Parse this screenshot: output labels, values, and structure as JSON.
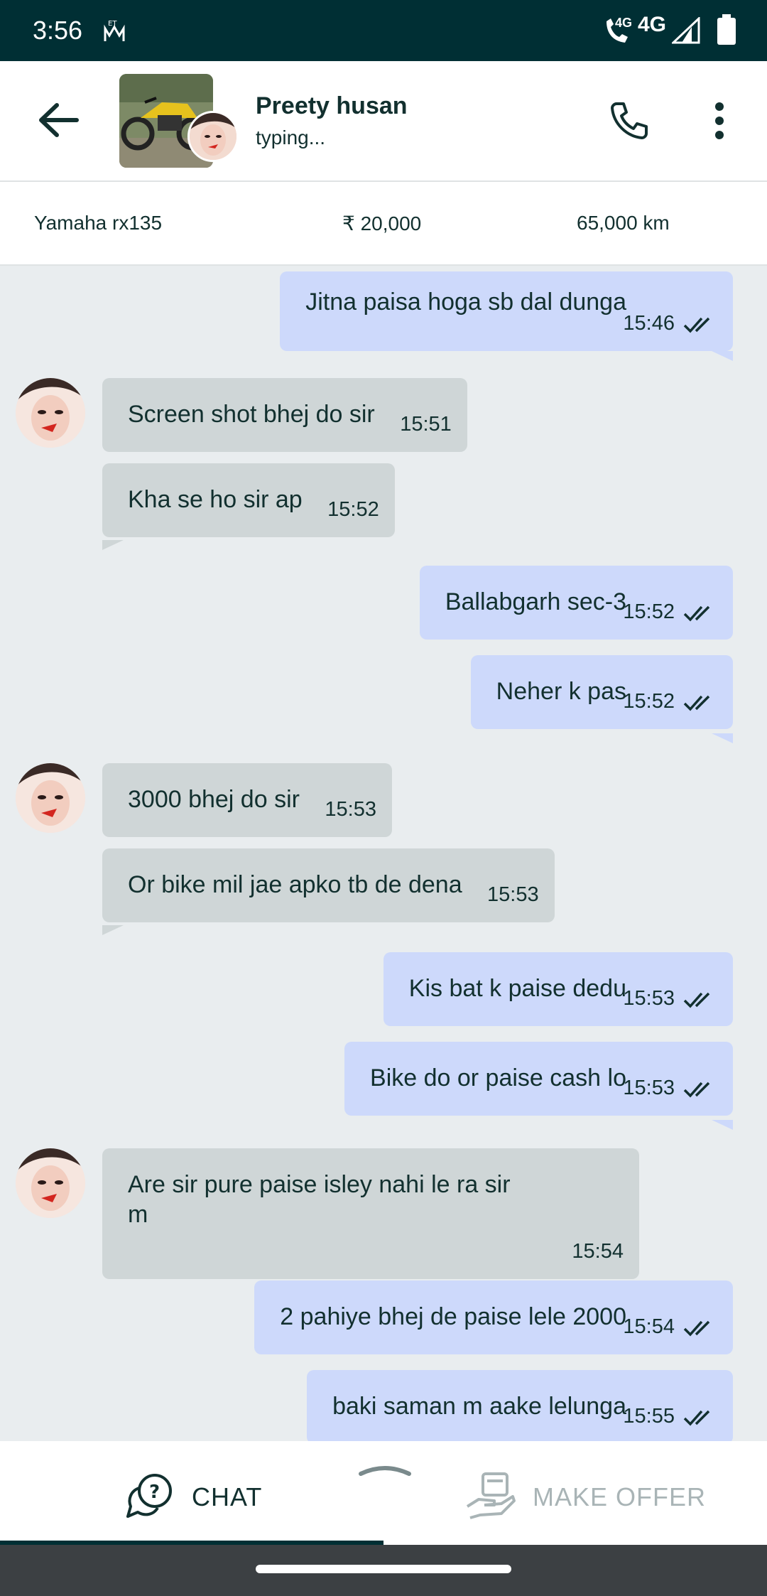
{
  "status_bar": {
    "time": "3:56",
    "network_small": "4G",
    "network": "4G",
    "icons": [
      "om-icon",
      "wifi-calling-icon",
      "signal-icon",
      "battery-icon"
    ]
  },
  "header": {
    "contact_name": "Preety husan",
    "contact_status": "typing...",
    "icons": [
      "back-arrow-icon",
      "phone-icon",
      "more-vert-icon"
    ]
  },
  "listing": {
    "title": "Yamaha rx135",
    "price": "₹ 20,000",
    "km": "65,000 km"
  },
  "messages": [
    {
      "dir": "out",
      "text": "Jitna paisa hoga sb dal dunga",
      "time": "15:46"
    },
    {
      "dir": "in",
      "text": "Screen shot bhej do sir",
      "time": "15:51"
    },
    {
      "dir": "in",
      "text": "Kha se ho sir ap",
      "time": "15:52"
    },
    {
      "dir": "out",
      "text": "Ballabgarh sec-3",
      "time": "15:52"
    },
    {
      "dir": "out",
      "text": "Neher k pas",
      "time": "15:52"
    },
    {
      "dir": "in",
      "text": "3000 bhej do sir",
      "time": "15:53"
    },
    {
      "dir": "in",
      "text": "Or bike mil jae apko tb de dena",
      "time": "15:53"
    },
    {
      "dir": "out",
      "text": "Kis bat k paise dedu",
      "time": "15:53"
    },
    {
      "dir": "out",
      "text": "Bike do or paise cash lo",
      "time": "15:53"
    },
    {
      "dir": "in",
      "text": "Are sir pure paise isley nahi le ra sir",
      "text2": "m",
      "time": "15:54"
    },
    {
      "dir": "out",
      "text": "2 pahiye bhej de paise lele 2000",
      "time": "15:54"
    },
    {
      "dir": "out",
      "text": "baki saman m aake lelunga",
      "time": "15:55"
    }
  ],
  "bottom_bar": {
    "chat_label": "CHAT",
    "offer_label": "MAKE OFFER"
  },
  "colors": {
    "status_bar": "#002f34",
    "outgoing_bubble": "#cdd9fb",
    "incoming_bubble": "#cfd6d7",
    "chat_background": "#e9edef"
  }
}
